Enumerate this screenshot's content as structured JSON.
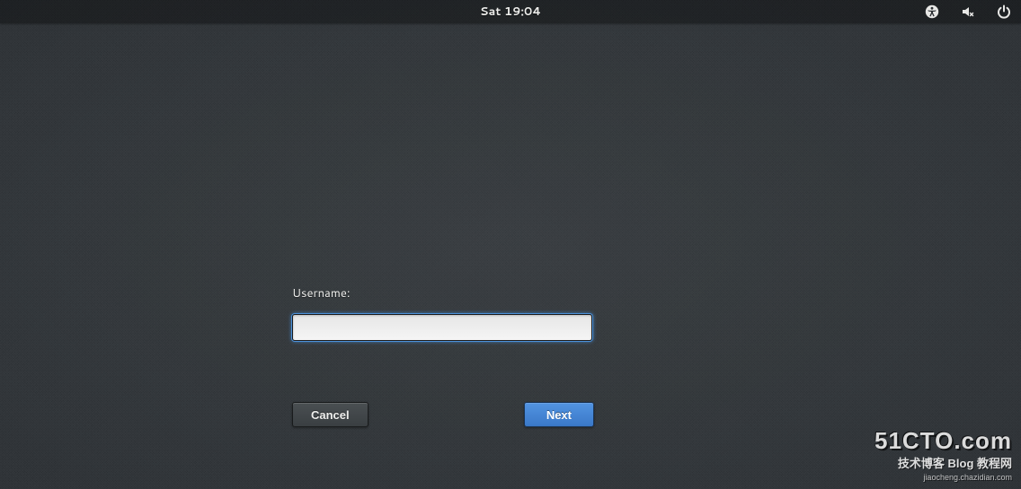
{
  "topbar": {
    "clock": "Sat 19:04",
    "icons": {
      "accessibility": "accessibility-icon",
      "volume": "volume-muted-icon",
      "power": "power-icon"
    }
  },
  "login": {
    "username_label": "Username:",
    "username_value": "",
    "cancel_label": "Cancel",
    "next_label": "Next"
  },
  "watermark": {
    "main": "51CTO.com",
    "sub": "技术博客   Blog   教程网",
    "url": "jiaocheng.chazidian.com"
  }
}
